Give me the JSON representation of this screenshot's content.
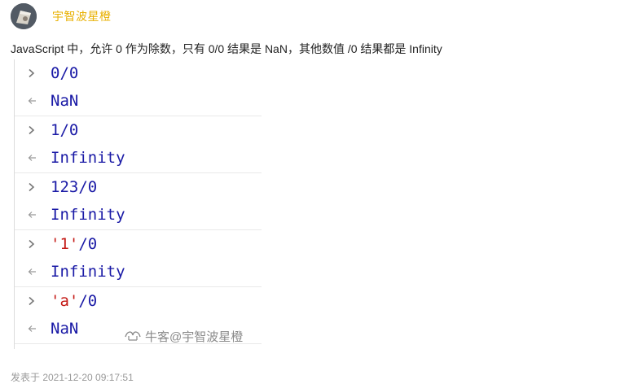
{
  "post": {
    "username": "宇智波星橙",
    "text": "JavaScript 中，允许 0 作为除数，只有 0/0 结果是 NaN，其他数值 /0 结果都是 Infinity",
    "timestamp": "发表于 2021-12-20 09:17:51"
  },
  "console": {
    "entries": [
      {
        "input_num": "0",
        "input_str": "",
        "input_rest": "/0",
        "output": "NaN"
      },
      {
        "input_num": "1",
        "input_str": "",
        "input_rest": "/0",
        "output": "Infinity"
      },
      {
        "input_num": "123",
        "input_str": "",
        "input_rest": "/0",
        "output": "Infinity"
      },
      {
        "input_num": "",
        "input_str": "'1'",
        "input_rest": "/0",
        "output": "Infinity"
      },
      {
        "input_num": "",
        "input_str": "'a'",
        "input_rest": "/0",
        "output": "NaN"
      }
    ]
  },
  "watermark": {
    "text": "牛客@宇智波星橙",
    "icon": "niuke-logo-icon"
  },
  "icons": {
    "input_prompt": "chevron-right-icon",
    "output_prompt": "return-arrow-icon"
  }
}
